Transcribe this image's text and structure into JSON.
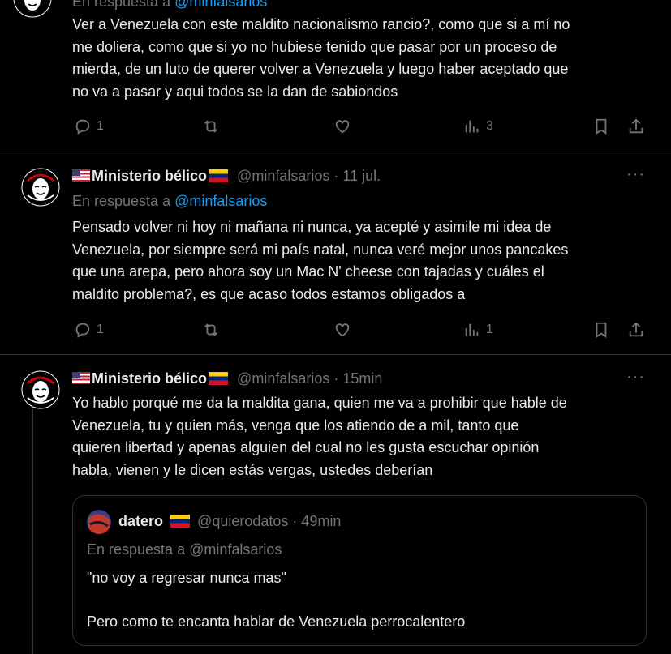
{
  "tweet0": {
    "reply_label": "En respuesta a",
    "reply_handle": "@minfalsarios",
    "text_lines": [
      "Ver a Venezuela con este maldito nacionalismo rancio?, como que si a mí no",
      "me doliera, como que si yo no hubiese tenido que pasar por un proceso de",
      "mierda, de un luto de querer volver a Venezuela y luego haber aceptado que",
      "no va a pasar y aqui todos se la dan de sabiondos"
    ],
    "replies": "1",
    "views": "3"
  },
  "tweet1": {
    "name": "Ministerio bélico",
    "handle": "@minfalsarios",
    "sep": "·",
    "time": "11 jul.",
    "reply_label": "En respuesta a",
    "reply_handle": "@minfalsarios",
    "text_lines": [
      "Pensado volver ni hoy ni mañana ni nunca, ya acepté y asimile mi idea de",
      "Venezuela, por siempre será mi país natal, nunca veré mejor unos pancakes",
      "que una arepa, pero ahora soy un Mac N' cheese con tajadas y cuáles el",
      "maldito problema?, es que acaso todos estamos obligados a"
    ],
    "replies": "1",
    "views": "1"
  },
  "tweet2": {
    "name": "Ministerio bélico",
    "handle": "@minfalsarios",
    "sep": "·",
    "time": "15min",
    "text_lines": [
      "Yo hablo porqué me da la maldita gana, quien me va a prohibir que hable de",
      "Venezuela, tu y quien más, venga que los atiendo de a mil, tanto que",
      "quieren libertad y apenas alguien del cual no les gusta escuchar opinión",
      "habla, vienen y le dicen estás vergas, ustedes deberían"
    ]
  },
  "quote": {
    "name": "datero",
    "handle": "@quierodatos",
    "sep": "·",
    "time": "49min",
    "reply_line": "En respuesta a @minfalsarios",
    "line1": "\"no voy a regresar nunca mas\"",
    "line2": "Pero como te encanta hablar de Venezuela perrocalentero"
  },
  "more_label": "···"
}
